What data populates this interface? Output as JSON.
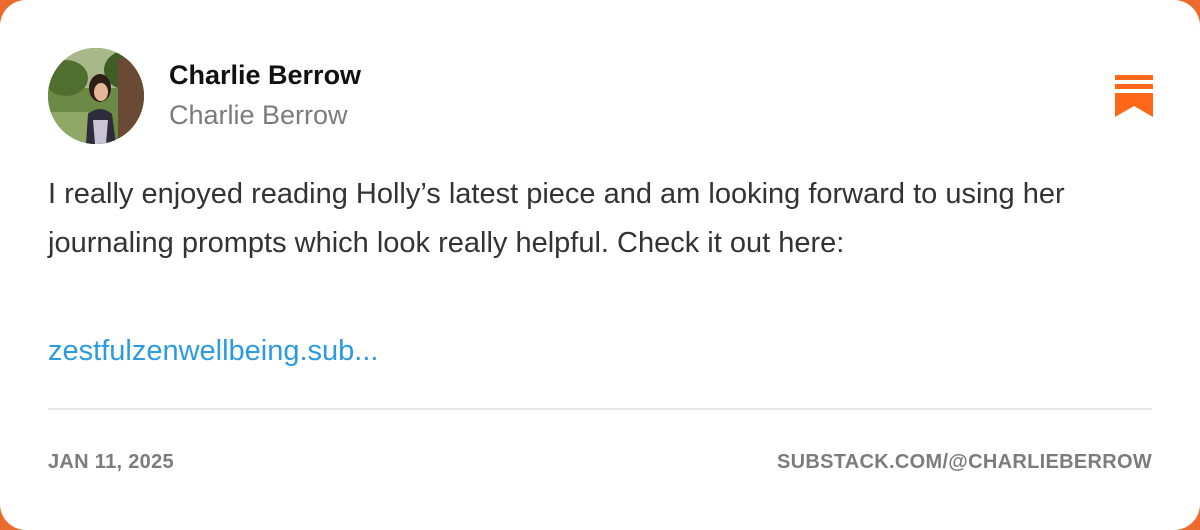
{
  "author": {
    "name": "Charlie Berrow",
    "handle": "Charlie Berrow",
    "avatar_alt": "avatar-photo"
  },
  "brand": {
    "icon": "substack-bookmark-icon",
    "accent_color": "#ec6a2b"
  },
  "post": {
    "text": "I really enjoyed reading Holly’s latest piece and am looking forward to using her journaling prompts which look really helpful. Check it out here:",
    "link_text": "zestfulzenwellbeing.sub...",
    "link_color": "#2b9be0"
  },
  "footer": {
    "date": "JAN 11, 2025",
    "profile_url": "SUBSTACK.COM/@CHARLIEBERROW"
  }
}
